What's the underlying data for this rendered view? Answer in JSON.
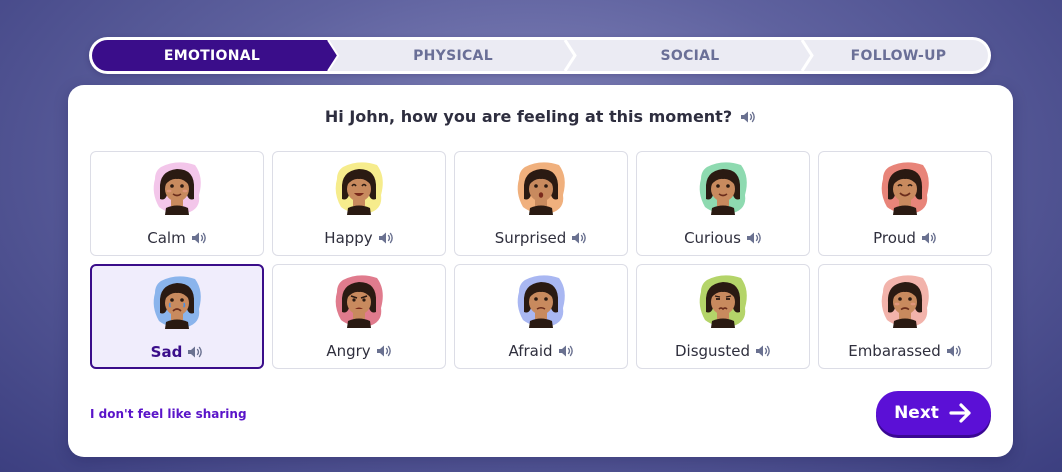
{
  "stepper": {
    "steps": [
      {
        "label": "EMOTIONAL",
        "state": "active"
      },
      {
        "label": "PHYSICAL",
        "state": "inactive"
      },
      {
        "label": "SOCIAL",
        "state": "inactive"
      },
      {
        "label": "FOLLOW-UP",
        "state": "inactive"
      }
    ]
  },
  "question": {
    "text": "Hi John, how you are feeling at this moment?",
    "audio_icon": "speaker-icon"
  },
  "emotions": [
    {
      "label": "Calm",
      "blob": "#f3c6ea",
      "expression": "calm",
      "selected": false
    },
    {
      "label": "Happy",
      "blob": "#f6ec8c",
      "expression": "happy",
      "selected": false
    },
    {
      "label": "Surprised",
      "blob": "#f0b07d",
      "expression": "surprised",
      "selected": false
    },
    {
      "label": "Curious",
      "blob": "#8edab0",
      "expression": "curious",
      "selected": false
    },
    {
      "label": "Proud",
      "blob": "#e88479",
      "expression": "proud",
      "selected": false
    },
    {
      "label": "Sad",
      "blob": "#8ab4ec",
      "expression": "sad",
      "selected": true
    },
    {
      "label": "Angry",
      "blob": "#e07b8d",
      "expression": "angry",
      "selected": false
    },
    {
      "label": "Afraid",
      "blob": "#a9b7f2",
      "expression": "afraid",
      "selected": false
    },
    {
      "label": "Disgusted",
      "blob": "#b4d469",
      "expression": "disgusted",
      "selected": false
    },
    {
      "label": "Embarassed",
      "blob": "#f2b3ab",
      "expression": "embarassed",
      "selected": false
    }
  ],
  "footer": {
    "decline_link": "I don't feel like sharing",
    "next_label": "Next",
    "next_icon": "arrow-right-icon"
  },
  "colors": {
    "accent": "#5b10d6",
    "stepper_active": "#3a0d8a",
    "selected_border": "#3a0d8a",
    "selected_bg": "#f0edfc"
  }
}
